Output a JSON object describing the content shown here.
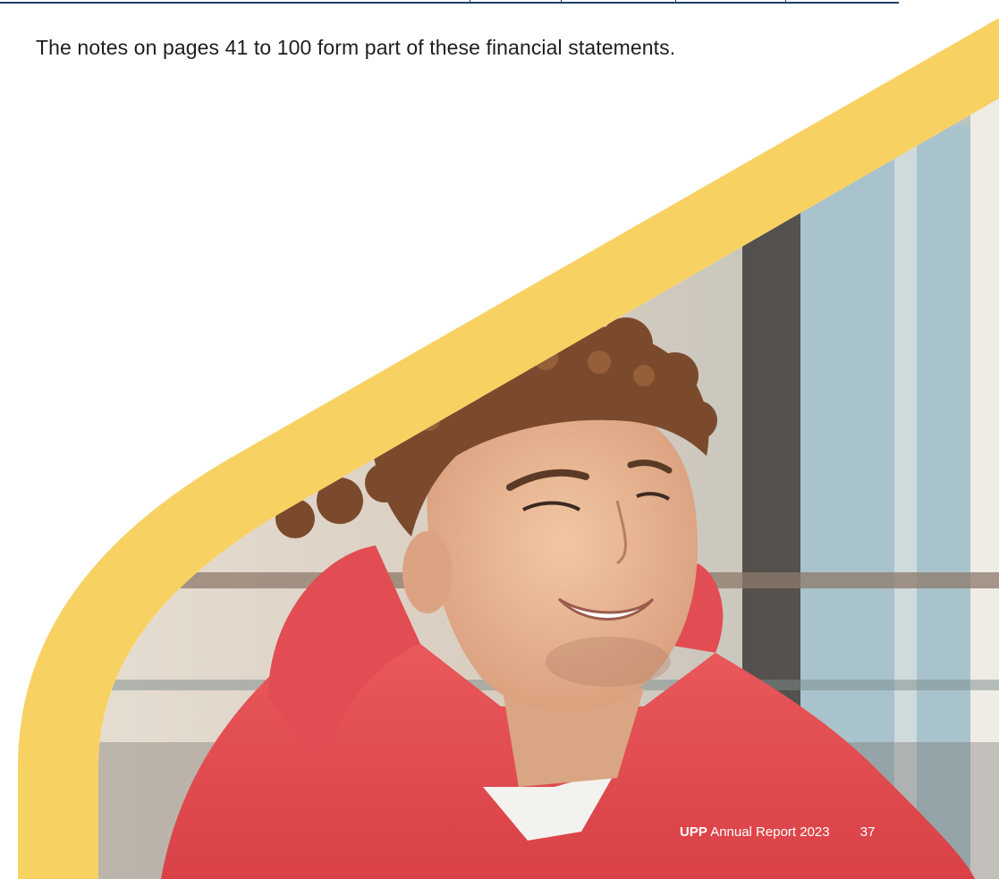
{
  "notes": "The notes on pages 41 to 100 form part of these financial statements.",
  "footer": {
    "brand": "UPP",
    "title": "Annual Report 2023",
    "page_number": "37"
  },
  "photo": {
    "subject": "student-portrait"
  },
  "colors": {
    "accent_yellow": "#f8d163",
    "rule_navy": "#1d3f6e",
    "hoodie_red": "#e04a4e"
  }
}
